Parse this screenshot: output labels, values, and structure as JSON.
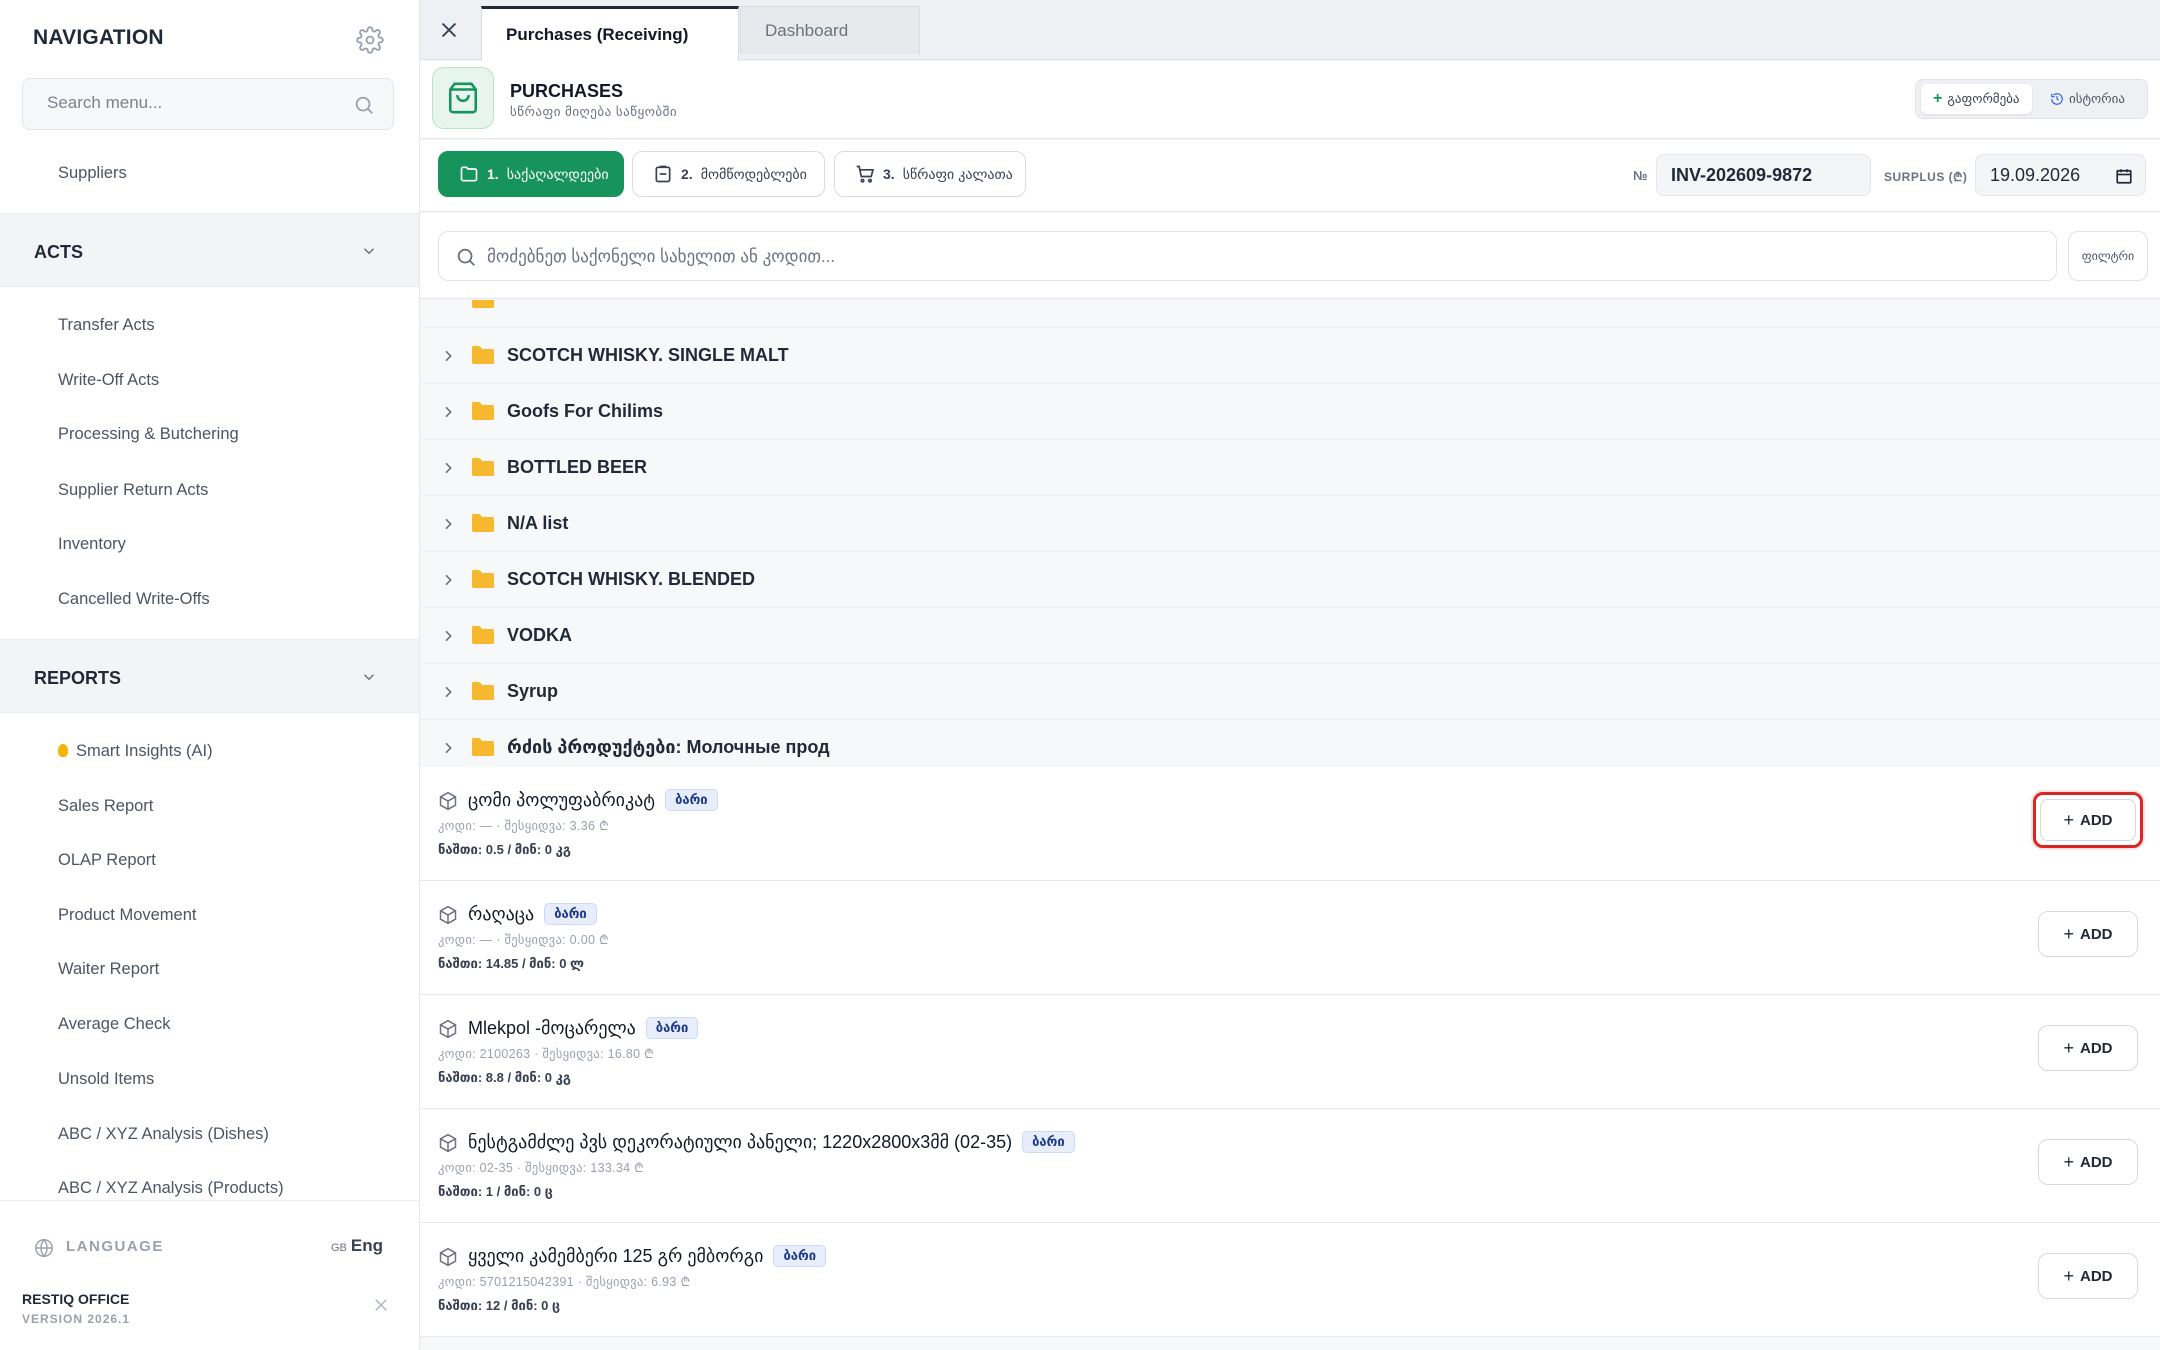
{
  "sidebar": {
    "title": "NAVIGATION",
    "search_placeholder": "Search menu...",
    "top_item": "Suppliers",
    "acts": {
      "title": "ACTS",
      "items": [
        "Transfer Acts",
        "Write-Off Acts",
        "Processing & Butchering",
        "Supplier Return Acts",
        "Inventory",
        "Cancelled Write-Offs"
      ]
    },
    "reports": {
      "title": "REPORTS",
      "items": [
        "Smart Insights (AI)",
        "Sales Report",
        "OLAP Report",
        "Product Movement",
        "Waiter Report",
        "Average Check",
        "Unsold Items",
        "ABC / XYZ Analysis (Dishes)",
        "ABC / XYZ Analysis (Products)"
      ]
    },
    "language_label": "LANGUAGE",
    "language_flag": "GB",
    "language_value": "Eng",
    "brand": "RESTIQ OFFICE",
    "version": "VERSION 2026.1"
  },
  "tabs": [
    {
      "label": "Purchases (Receiving)",
      "active": true
    },
    {
      "label": "Dashboard",
      "active": false
    }
  ],
  "header": {
    "title": "PURCHASES",
    "subtitle": "სწრაფი მიღება საწყობში",
    "btn_new": "გაფორმება",
    "btn_history": "ისტორია"
  },
  "steps": [
    {
      "num": "1.",
      "label": "საქაღალდეები",
      "active": true
    },
    {
      "num": "2.",
      "label": "მომწოდებლები",
      "active": false
    },
    {
      "num": "3.",
      "label": "სწრაფი კალათა",
      "active": false
    }
  ],
  "invoice": {
    "no_label": "№",
    "number": "INV-202609-9872",
    "surplus_label": "SURPLUS (₾)",
    "date": "19.09.2026"
  },
  "product_search": {
    "placeholder": "მოძებნეთ საქონელი სახელით ან კოდით...",
    "filter_label": "ფილტრი"
  },
  "categories": [
    "SCOTCH WHISKY. SINGLE MALT",
    "Goofs For Chilims",
    "BOTTLED BEER",
    "N/A list",
    "SCOTCH WHISKY. BLENDED",
    "VODKA",
    "Syrup",
    "რძის პროდუქტები: Молочные прод"
  ],
  "products": [
    {
      "name": "ცომი პოლუფაბრიკატ",
      "badge": "ბარი",
      "meta": "კოდი: — · შესყიდვა: 3.36 ₾",
      "stock": "ნაშთი: 0.5 / მინ: 0 კგ",
      "add": "ADD"
    },
    {
      "name": "რაღაცა",
      "badge": "ბარი",
      "meta": "კოდი: — · შესყიდვა: 0.00 ₾",
      "stock": "ნაშთი: 14.85 / მინ: 0 ლ",
      "add": "ADD"
    },
    {
      "name": "Mlekpol -მოცარელა",
      "badge": "ბარი",
      "meta": "კოდი: 2100263 · შესყიდვა: 16.80 ₾",
      "stock": "ნაშთი: 8.8 / მინ: 0 კგ",
      "add": "ADD"
    },
    {
      "name": "ნესტგამძლე პვს დეკორატიული პანელი; 1220x2800x3მმ (02-35)",
      "badge": "ბარი",
      "meta": "კოდი: 02-35 · შესყიდვა: 133.34 ₾",
      "stock": "ნაშთი: 1 / მინ: 0 ც",
      "add": "ADD"
    },
    {
      "name": "ყველი კამემბერი 125 გრ ემბორგი",
      "badge": "ბარი",
      "meta": "კოდი: 5701215042391 · შესყიდვა: 6.93 ₾",
      "stock": "ნაშთი: 12 / მინ: 0 ც",
      "add": "ADD"
    }
  ]
}
